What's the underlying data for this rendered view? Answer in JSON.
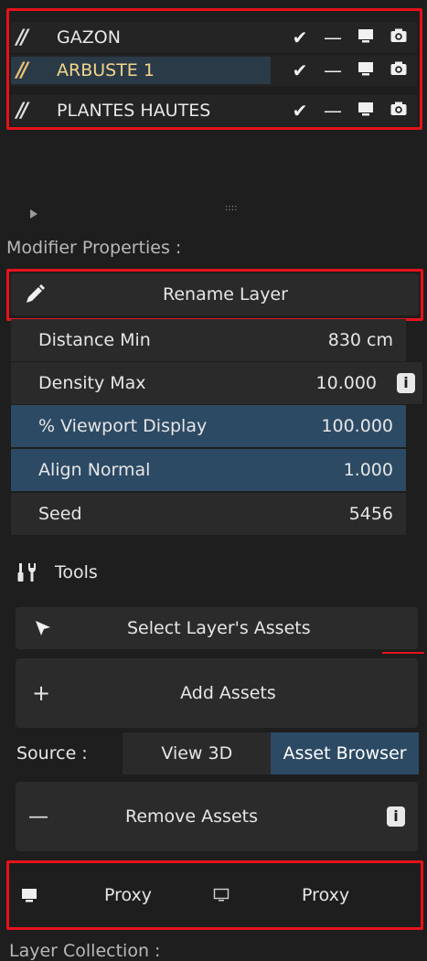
{
  "layers": [
    {
      "name": "GAZON",
      "icon": "grass-icon",
      "selected": false
    },
    {
      "name": "ARBUSTE 1",
      "icon": "grass-icon",
      "selected": true
    },
    {
      "name": "PLANTES HAUTES",
      "icon": "grass-icon",
      "selected": false
    }
  ],
  "layer_icons": {
    "check": "✔",
    "dash": "—"
  },
  "panel_grip": "::::",
  "modifier_header": "Modifier Properties :",
  "rename_label": "Rename Layer",
  "props": [
    {
      "label": "Distance Min",
      "value": "830 cm"
    },
    {
      "label": "Density Max",
      "value": "10.000"
    },
    {
      "label": "% Viewport Display",
      "value": "100.000"
    },
    {
      "label": "Align Normal",
      "value": "1.000"
    },
    {
      "label": "Seed",
      "value": "5456"
    }
  ],
  "info_glyph": "i",
  "tools_header": "Tools",
  "select_assets_label": "Select Layer's Assets",
  "add_assets": {
    "symbol": "+",
    "label": "Add Assets"
  },
  "source": {
    "label": "Source :",
    "options": [
      "View 3D",
      "Asset Browser"
    ],
    "selected": "Asset Browser"
  },
  "remove_assets": {
    "symbol": "—",
    "label": "Remove Assets"
  },
  "proxy": {
    "viewport_label": "Proxy",
    "render_label": "Proxy"
  },
  "layer_collection_header": "Layer Collection :",
  "colors": {
    "accent_blue": "#2c4a64",
    "selected_layer": "#f2d58c",
    "highlight_red": "#e8121b"
  }
}
